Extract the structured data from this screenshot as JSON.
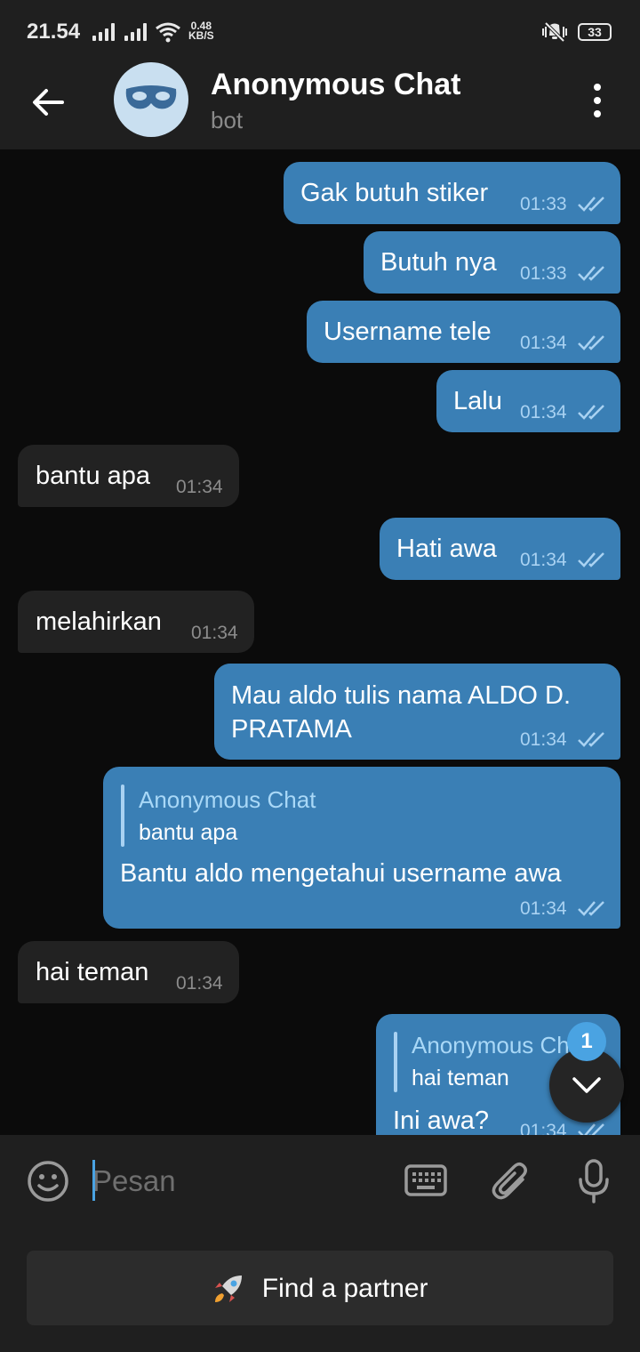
{
  "status_bar": {
    "time": "21.54",
    "net_speed_value": "0.48",
    "net_speed_unit": "KB/S",
    "battery": "33"
  },
  "header": {
    "title": "Anonymous Chat",
    "subtitle": "bot"
  },
  "messages": [
    {
      "dir": "out",
      "text": "Gak butuh stiker",
      "time": "01:33"
    },
    {
      "dir": "out",
      "text": "Butuh nya",
      "time": "01:33"
    },
    {
      "dir": "out",
      "text": "Username tele",
      "time": "01:34"
    },
    {
      "dir": "out",
      "text": "Lalu",
      "time": "01:34"
    },
    {
      "dir": "in",
      "text": "bantu apa",
      "time": "01:34"
    },
    {
      "dir": "out",
      "text": "Hati awa",
      "time": "01:34"
    },
    {
      "dir": "in",
      "text": "melahirkan",
      "time": "01:34"
    },
    {
      "dir": "out",
      "text_line1": "Mau aldo tulis nama ALDO D.",
      "text_line2": "PRATAMA",
      "time": "01:34"
    },
    {
      "dir": "out",
      "reply_name": "Anonymous Chat",
      "reply_text": "bantu apa",
      "text": "Bantu aldo mengetahui username awa",
      "time": "01:34"
    },
    {
      "dir": "in",
      "text": "hai teman",
      "time": "01:34"
    },
    {
      "dir": "out",
      "reply_name": "Anonymous Chat",
      "reply_text": "hai teman",
      "text": "Ini awa?",
      "time": "01:34"
    }
  ],
  "unread_badge": "1",
  "input": {
    "placeholder": "Pesan"
  },
  "bottom_button": {
    "label": "Find a partner",
    "icon": "rocket-icon"
  },
  "colors": {
    "outgoing_bubble": "#3a7fb5",
    "incoming_bubble": "#222222",
    "accent": "#4aa3e2",
    "background": "#0b0b0b"
  }
}
